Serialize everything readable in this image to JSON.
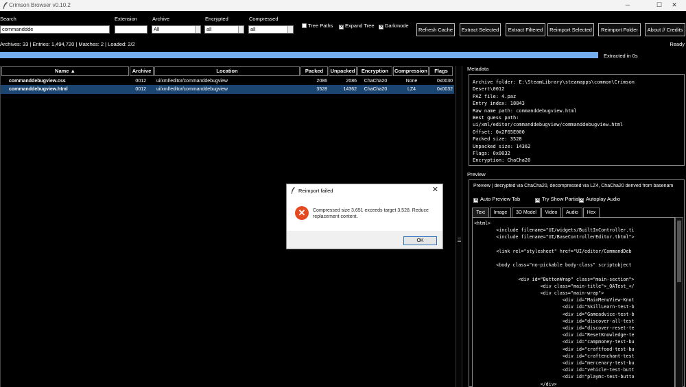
{
  "window": {
    "title": "Crimson Browser v0.10.2"
  },
  "filters": {
    "search_label": "Search",
    "search_value": "commanddde",
    "extension_label": "Extension",
    "extension_value": "",
    "archive_label": "Archive",
    "archive_value": "All",
    "encrypted_label": "Encrypted",
    "encrypted_value": "all",
    "compressed_label": "Compressed",
    "compressed_value": "all"
  },
  "options": {
    "tree_paths": {
      "label": "Tree Paths",
      "checked": false
    },
    "expand_tree": {
      "label": "Expand Tree",
      "checked": true
    },
    "darkmode": {
      "label": "Darkmode",
      "checked": true
    }
  },
  "buttons": {
    "refresh_cache": "Refresh Cache",
    "extract_selected": "Extract Selected",
    "extract_filtered": "Extract Filtered",
    "reimport_selected": "Reimport Selected",
    "reimport_folder": "Reimport Folder",
    "about": "About // Credits"
  },
  "status": {
    "stats": "Archives: 33 | Entries: 1,494,720 | Matches: 2 | Loaded: 2/2",
    "ready": "Ready",
    "progress_text": "Extracted in 0s",
    "progress_fraction": 1.0
  },
  "table": {
    "columns": [
      "Name ▲",
      "Archive",
      "Location",
      "Packed",
      "Unpacked",
      "Encryption",
      "Compression",
      "Flags"
    ],
    "rows": [
      {
        "name": "commanddebugview.css",
        "archive": "0012",
        "location": "ui/xml/editor/commanddebugview",
        "packed": "2086",
        "unpacked": "2086",
        "encryption": "ChaCha20",
        "compression": "None",
        "flags": "0x0030",
        "selected": false
      },
      {
        "name": "commanddebugview.html",
        "archive": "0012",
        "location": "ui/xml/editor/commanddebugview",
        "packed": "3528",
        "unpacked": "14362",
        "encryption": "ChaCha20",
        "compression": "LZ4",
        "flags": "0x0032",
        "selected": true
      }
    ]
  },
  "metadata": {
    "label": "Metadata",
    "text": "Archive folder: E:\\SteamLibrary\\steamapps\\common\\Crimson\nDesert\\0012\nPAZ file: 4.paz\nEntry index: 18843\nRaw name path: commanddebugview.html\nBest guess path:\nui/xml/editor/commanddebugview/commanddebugview.html\nOffset: 0x2F65E000\nPacked size: 3528\nUnpacked size: 14362\nFlags: 0x0032\nEncryption: ChaCha20"
  },
  "preview": {
    "label": "Preview",
    "info": "Preview | decrypted via ChaCha20, decompressed via LZ4, ChaCha20 derived from basenam",
    "auto_preview_tab": {
      "label": "Auto Preview Tab",
      "checked": true
    },
    "try_show_partial": {
      "label": "Try Show Partial",
      "checked": true
    },
    "autoplay_audio": {
      "label": "Autoplay Audio",
      "checked": true
    },
    "tabs": [
      "Text",
      "Image",
      "3D Model",
      "Video",
      "Audio",
      "Hex"
    ],
    "active_tab": "Text",
    "code": "<html>\n        <include filename=\"UI/widgets/BuiltInController.ti\n        <include filename=\"UI/BaseControllerEditor.thtml\">\n\n        <link rel=\"stylesheet\" href=\"UI/editor/CommandDeb\n\n        <body class=\"no-pickable body-class\" scriptobject\n\n                <div id=\"ButtonWrap\" class=\"main-section\">\n                        <div class=\"main-title\">_QATest_</\n                        <div class=\"main-wrap\">\n                                <div id=\"MainMenuView-Knot\n                                <div id=\"SkillLearn-test-b\n                                <div id=\"Gameadvice-test-b\n                                <div id=\"discover-all-test\n                                <div id=\"discover-reset-te\n                                <div id=\"ResetKnowledge-te\n                                <div id=\"campmoney-test-bu\n                                <div id=\"craftfood-test-bu\n                                <div id=\"craftenchant-test\n                                <div id=\"mercenary-test-bu\n                                <div id=\"vehicle-test-butt\n                                <div id=\"playmc-test-butto\n                        </div>"
  },
  "dialog": {
    "title": "Reimport failed",
    "message": "Compressed size 3,651 exceeds target 3,528. Reduce replacement content.",
    "ok": "OK"
  },
  "colors": {
    "selection": "#1c4672",
    "progress": "#74aef0",
    "error": "#e4491f"
  }
}
